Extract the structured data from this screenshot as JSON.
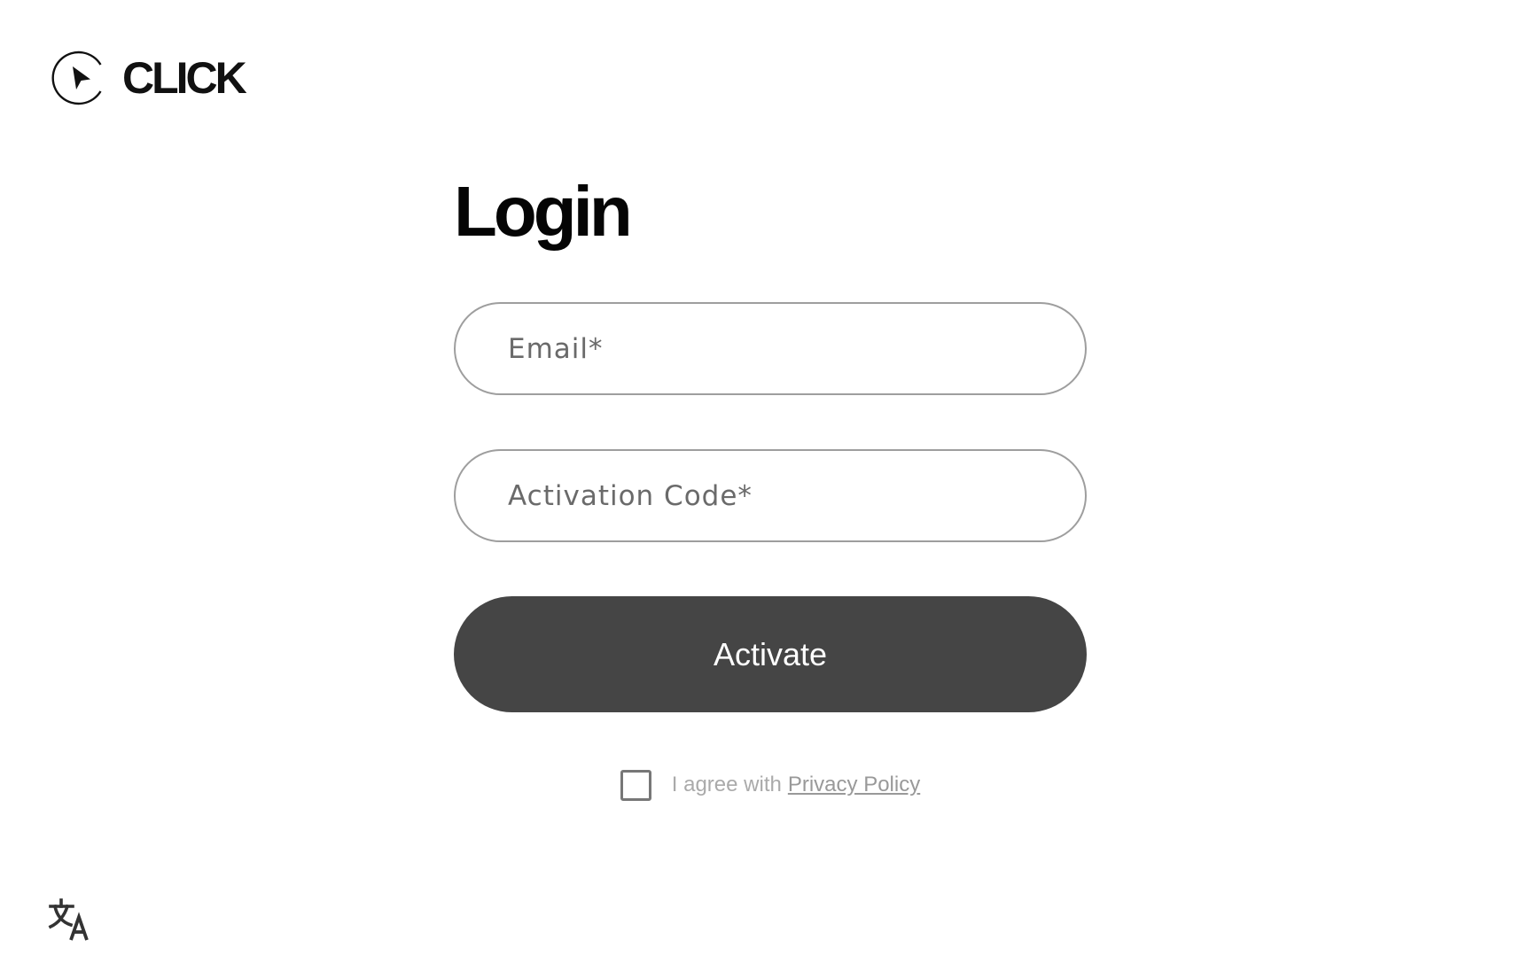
{
  "brand": {
    "name": "CLICK",
    "icon": "cursor-circle-icon"
  },
  "login": {
    "title": "Login",
    "email_placeholder": "Email*",
    "code_placeholder": "Activation Code*",
    "activate_label": "Activate",
    "agree_text": "I agree with",
    "privacy_link": "Privacy Policy",
    "agree_checked": false
  },
  "footer": {
    "language_icon": "translate-icon"
  },
  "colors": {
    "button_background": "#454545",
    "field_border": "#9e9e9e",
    "muted_text": "#aaaaaa"
  }
}
